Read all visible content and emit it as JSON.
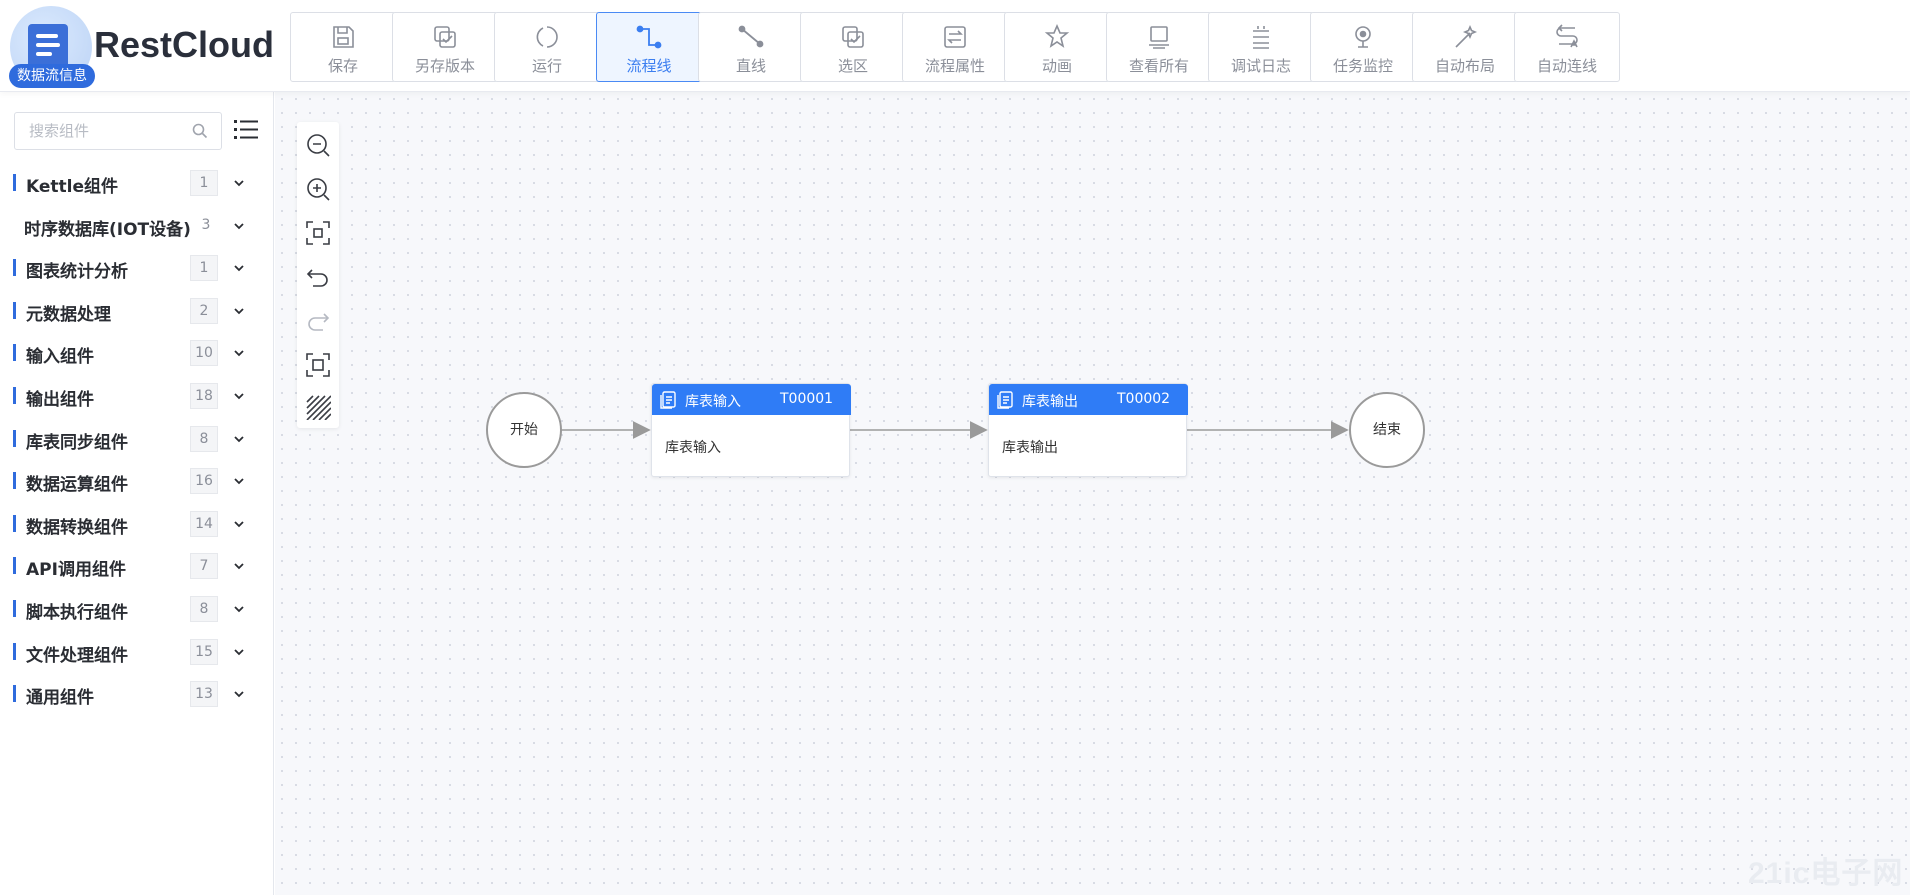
{
  "app": {
    "brand": "RestCloud",
    "tag": "数据流信息"
  },
  "toolbar": [
    {
      "label": "保存",
      "icon": "save-icon"
    },
    {
      "label": "另存版本",
      "icon": "save-version-icon"
    },
    {
      "label": "运行",
      "icon": "run-icon"
    },
    {
      "label": "流程线",
      "icon": "flow-line-icon",
      "active": true
    },
    {
      "label": "直线",
      "icon": "straight-line-icon"
    },
    {
      "label": "选区",
      "icon": "select-area-icon"
    },
    {
      "label": "流程属性",
      "icon": "flow-properties-icon"
    },
    {
      "label": "动画",
      "icon": "animation-icon"
    },
    {
      "label": "查看所有",
      "icon": "view-all-icon"
    },
    {
      "label": "调试日志",
      "icon": "debug-log-icon"
    },
    {
      "label": "任务监控",
      "icon": "task-monitor-icon"
    },
    {
      "label": "自动布局",
      "icon": "auto-layout-icon"
    },
    {
      "label": "自动连线",
      "icon": "auto-connect-icon"
    }
  ],
  "sidebar": {
    "search_placeholder": "搜索组件",
    "categories": [
      {
        "label": "Kettle组件",
        "count": "1"
      },
      {
        "label": "时序数据库(IOT设备)",
        "count": "3"
      },
      {
        "label": "图表统计分析",
        "count": "1"
      },
      {
        "label": "元数据处理",
        "count": "2"
      },
      {
        "label": "输入组件",
        "count": "10"
      },
      {
        "label": "输出组件",
        "count": "18"
      },
      {
        "label": "库表同步组件",
        "count": "8"
      },
      {
        "label": "数据运算组件",
        "count": "16"
      },
      {
        "label": "数据转换组件",
        "count": "14"
      },
      {
        "label": "API调用组件",
        "count": "7"
      },
      {
        "label": "脚本执行组件",
        "count": "8"
      },
      {
        "label": "文件处理组件",
        "count": "15"
      },
      {
        "label": "通用组件",
        "count": "13"
      }
    ]
  },
  "canvas": {
    "start_label": "开始",
    "end_label": "结束",
    "nodes": [
      {
        "title": "库表输入",
        "code": "T00001",
        "description": "库表输入"
      },
      {
        "title": "库表输出",
        "code": "T00002",
        "description": "库表输出"
      }
    ],
    "zoom_tools": [
      "zoom-out-icon",
      "zoom-in-icon",
      "fit-view-icon",
      "undo-icon",
      "redo-icon",
      "actual-size-icon",
      "grid-toggle-icon"
    ]
  },
  "watermark": "21ic电子网",
  "colors": {
    "accent": "#2f7cf6",
    "brand": "#2f6bdd",
    "edge": "#9a9a9a"
  }
}
